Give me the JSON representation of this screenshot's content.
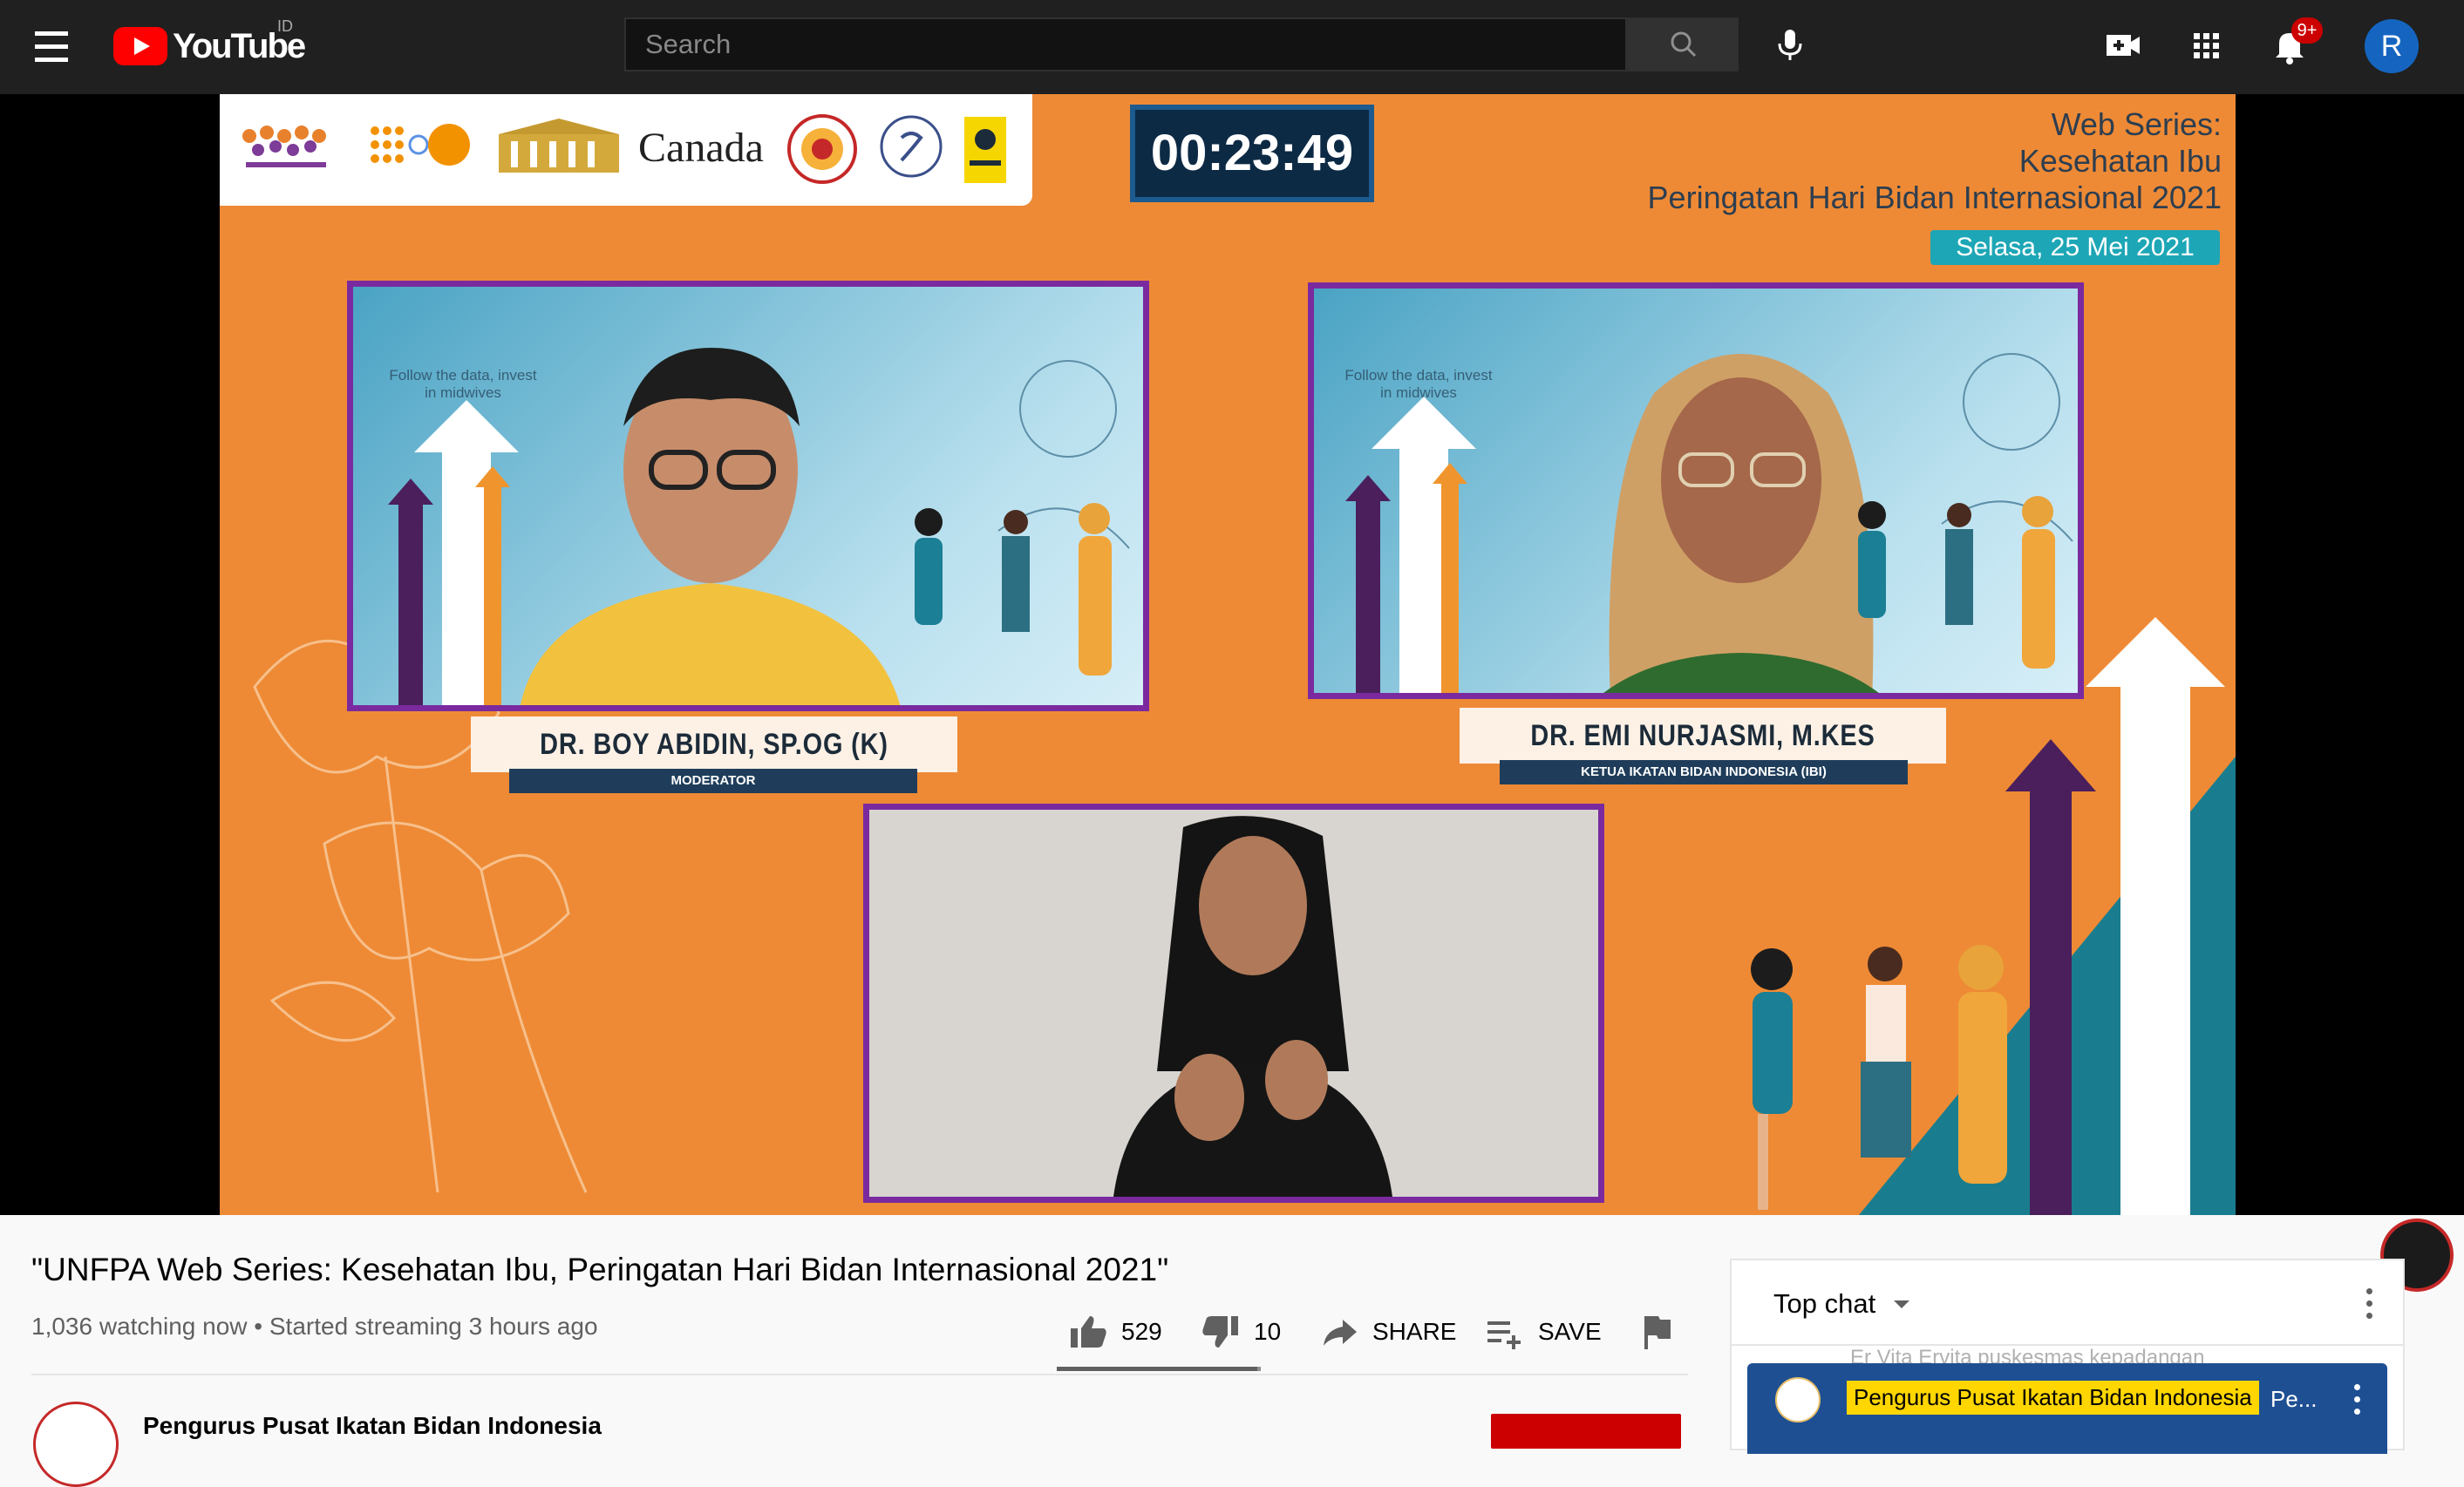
{
  "masthead": {
    "logo_text": "YouTube",
    "country_code": "ID",
    "search_placeholder": "Search",
    "notification_count": "9+",
    "avatar_initial": "R"
  },
  "video_frame": {
    "logos": [
      "KNOWLEDGE HUB",
      "UNFPA",
      "KANTOR STAF PRESIDEN",
      "Canada",
      "IBI",
      "ASAH",
      "UNIVERSITAS"
    ],
    "canada_text": "Canada",
    "timer": "00:23:49",
    "series_line1": "Web Series:",
    "series_line2": "Kesehatan Ibu",
    "series_line3": "Peringatan Hari Bidan Internasional 2021",
    "series_date": "Selasa, 25 Mei 2021",
    "slogan": "Follow the data, invest in midwives",
    "speaker1_name": "DR. BOY ABIDIN, SP.OG (K)",
    "speaker1_role": "MODERATOR",
    "speaker2_name": "DR. EMI NURJASMI, M.KES",
    "speaker2_role": "KETUA IKATAN BIDAN INDONESIA (IBI)"
  },
  "video": {
    "title": "\"UNFPA Web Series: Kesehatan Ibu, Peringatan Hari Bidan Internasional 2021\"",
    "meta": "1,036 watching now • Started streaming 3 hours ago",
    "like_count": "529",
    "dislike_count": "10",
    "share_label": "SHARE",
    "save_label": "SAVE",
    "like_ratio": 0.981
  },
  "channel": {
    "name": "Pengurus Pusat Ikatan Bidan Indonesia"
  },
  "chat": {
    "mode": "Top chat",
    "faded_message": "Er Vita  Ervita puskesmas kepadangan",
    "pinned_author": "Pengurus Pusat Ikatan Bidan Indonesia",
    "pinned_message": "Pe..."
  },
  "colors": {
    "brand_red": "#ff0000",
    "frame_orange": "#ee8a35",
    "panel_border": "#7a2a9e",
    "chat_pinned_bg": "#1e4f93",
    "author_highlight": "#ffd600"
  }
}
